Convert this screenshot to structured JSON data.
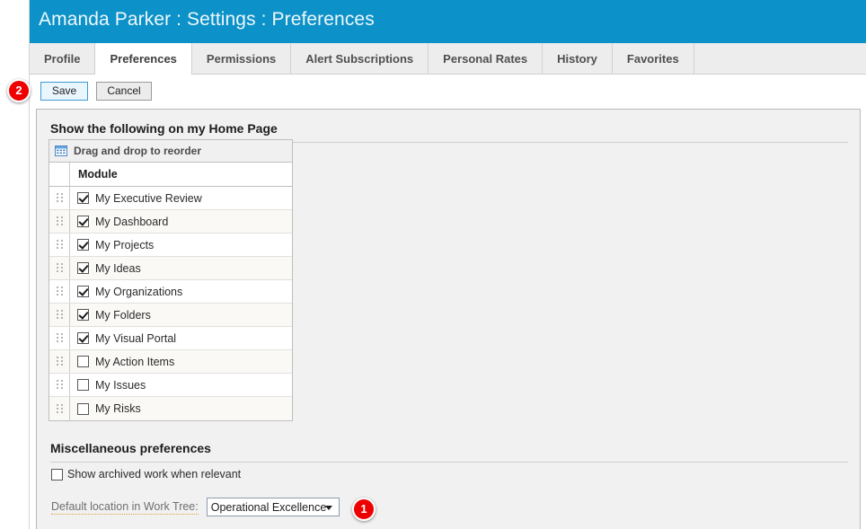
{
  "header": {
    "title": "Amanda Parker : Settings : Preferences",
    "accent_color": "#0c92c8"
  },
  "tabs": [
    {
      "label": "Profile",
      "active": false
    },
    {
      "label": "Preferences",
      "active": true
    },
    {
      "label": "Permissions",
      "active": false
    },
    {
      "label": "Alert Subscriptions",
      "active": false
    },
    {
      "label": "Personal Rates",
      "active": false
    },
    {
      "label": "History",
      "active": false
    },
    {
      "label": "Favorites",
      "active": false
    }
  ],
  "toolbar": {
    "save_label": "Save",
    "cancel_label": "Cancel"
  },
  "home_page_section": {
    "title": "Show the following on my Home Page",
    "reorder_caption": "Drag and drop to reorder",
    "column_header": "Module",
    "modules": [
      {
        "label": "My Executive Review",
        "checked": true
      },
      {
        "label": "My Dashboard",
        "checked": true
      },
      {
        "label": "My Projects",
        "checked": true
      },
      {
        "label": "My Ideas",
        "checked": true
      },
      {
        "label": "My Organizations",
        "checked": true
      },
      {
        "label": "My Folders",
        "checked": true
      },
      {
        "label": "My Visual Portal",
        "checked": true
      },
      {
        "label": "My Action Items",
        "checked": false
      },
      {
        "label": "My Issues",
        "checked": false
      },
      {
        "label": "My Risks",
        "checked": false
      }
    ]
  },
  "misc_section": {
    "title": "Miscellaneous preferences",
    "show_archived": {
      "label": "Show archived work when relevant",
      "checked": false
    },
    "default_location": {
      "label": "Default location in Work Tree:",
      "value": "Operational Excellence"
    }
  },
  "callouts": [
    {
      "number": "1"
    },
    {
      "number": "2"
    }
  ]
}
